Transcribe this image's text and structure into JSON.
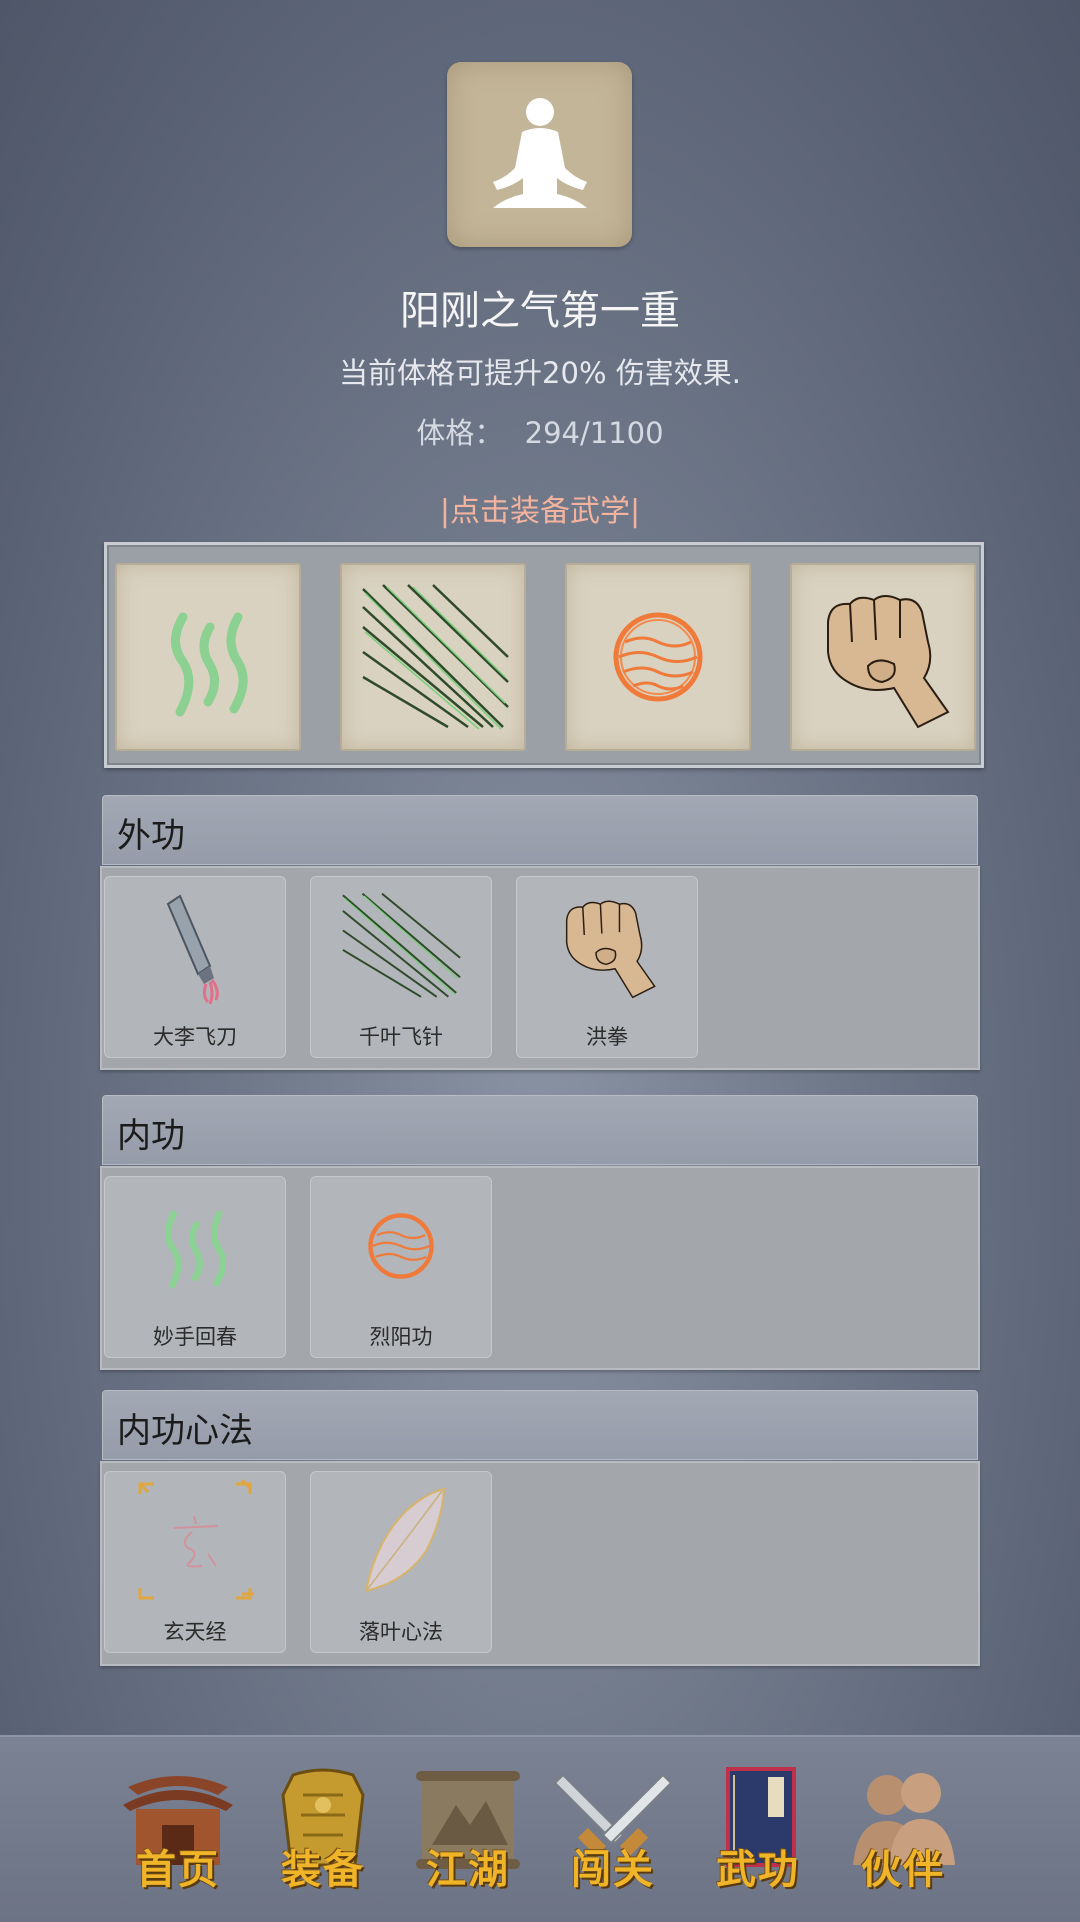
{
  "header": {
    "avatar_icon": "meditation-icon",
    "title": "阳刚之气第一重",
    "description": "当前体格可提升20% 伤害效果.",
    "stat_label": "体格：",
    "stat_value": "294/1100",
    "equip_hint": "|点击装备武学|"
  },
  "equipped": [
    {
      "icon": "healing-wave-icon"
    },
    {
      "icon": "flying-needles-icon"
    },
    {
      "icon": "sun-orb-icon"
    },
    {
      "icon": "fist-icon"
    }
  ],
  "categories": [
    {
      "title": "外功",
      "skills": [
        {
          "name": "大李飞刀",
          "icon": "flying-knife-icon"
        },
        {
          "name": "千叶飞针",
          "icon": "flying-needles-icon"
        },
        {
          "name": "洪拳",
          "icon": "fist-icon"
        }
      ]
    },
    {
      "title": "内功",
      "skills": [
        {
          "name": "妙手回春",
          "icon": "healing-wave-icon"
        },
        {
          "name": "烈阳功",
          "icon": "sun-orb-icon"
        }
      ]
    },
    {
      "title": "内功心法",
      "skills": [
        {
          "name": "玄天经",
          "icon": "xuan-scroll-icon"
        },
        {
          "name": "落叶心法",
          "icon": "leaf-icon"
        }
      ]
    }
  ],
  "nav": [
    {
      "label": "首页",
      "icon": "home-temple-icon"
    },
    {
      "label": "装备",
      "icon": "armor-icon"
    },
    {
      "label": "江湖",
      "icon": "map-scroll-icon"
    },
    {
      "label": "闯关",
      "icon": "crossed-swords-icon"
    },
    {
      "label": "武功",
      "icon": "martial-book-icon"
    },
    {
      "label": "伙伴",
      "icon": "companions-icon"
    }
  ],
  "colors": {
    "equip_hint": "#f3b39e",
    "nav_label": "#f0b428",
    "orb": "#f07a3a",
    "healing": "#7fd08a"
  }
}
